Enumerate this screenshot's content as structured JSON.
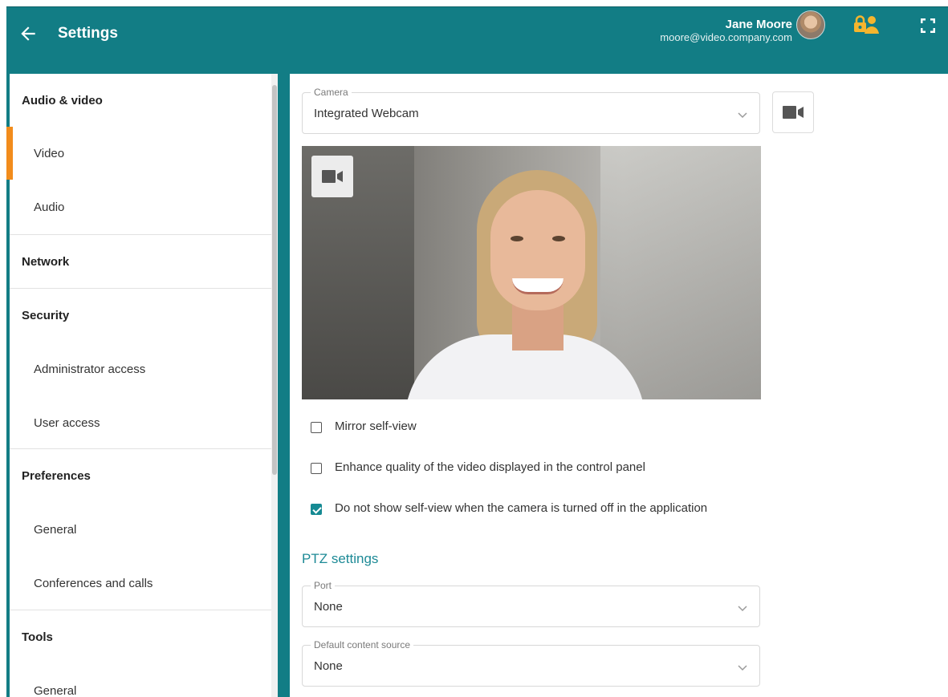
{
  "header": {
    "title": "Settings",
    "user_name": "Jane Moore",
    "user_email": "moore@video.company.com",
    "color": "#127d85"
  },
  "sidebar": {
    "accent_color": "#f28c1c",
    "items": [
      {
        "label": "Audio & video",
        "type": "section"
      },
      {
        "label": "Video",
        "type": "sub",
        "active": true
      },
      {
        "label": "Audio",
        "type": "sub"
      },
      {
        "label": "Network",
        "type": "section"
      },
      {
        "label": "Security",
        "type": "section"
      },
      {
        "label": "Administrator access",
        "type": "sub"
      },
      {
        "label": "User access",
        "type": "sub"
      },
      {
        "label": "Preferences",
        "type": "section"
      },
      {
        "label": "General",
        "type": "sub"
      },
      {
        "label": "Conferences and calls",
        "type": "sub"
      },
      {
        "label": "Tools",
        "type": "section"
      },
      {
        "label": "General",
        "type": "sub"
      }
    ]
  },
  "camera": {
    "label": "Camera",
    "value": "Integrated Webcam"
  },
  "options": {
    "mirror": {
      "label": "Mirror self-view",
      "checked": false
    },
    "enhance": {
      "label": "Enhance quality of the video displayed in the control panel",
      "checked": false
    },
    "hide_self": {
      "label": "Do not show self-view when the camera is turned off in the application",
      "checked": true
    }
  },
  "ptz": {
    "title": "PTZ settings",
    "port_label": "Port",
    "port_value": "None",
    "content_label": "Default content source",
    "content_value": "None"
  }
}
